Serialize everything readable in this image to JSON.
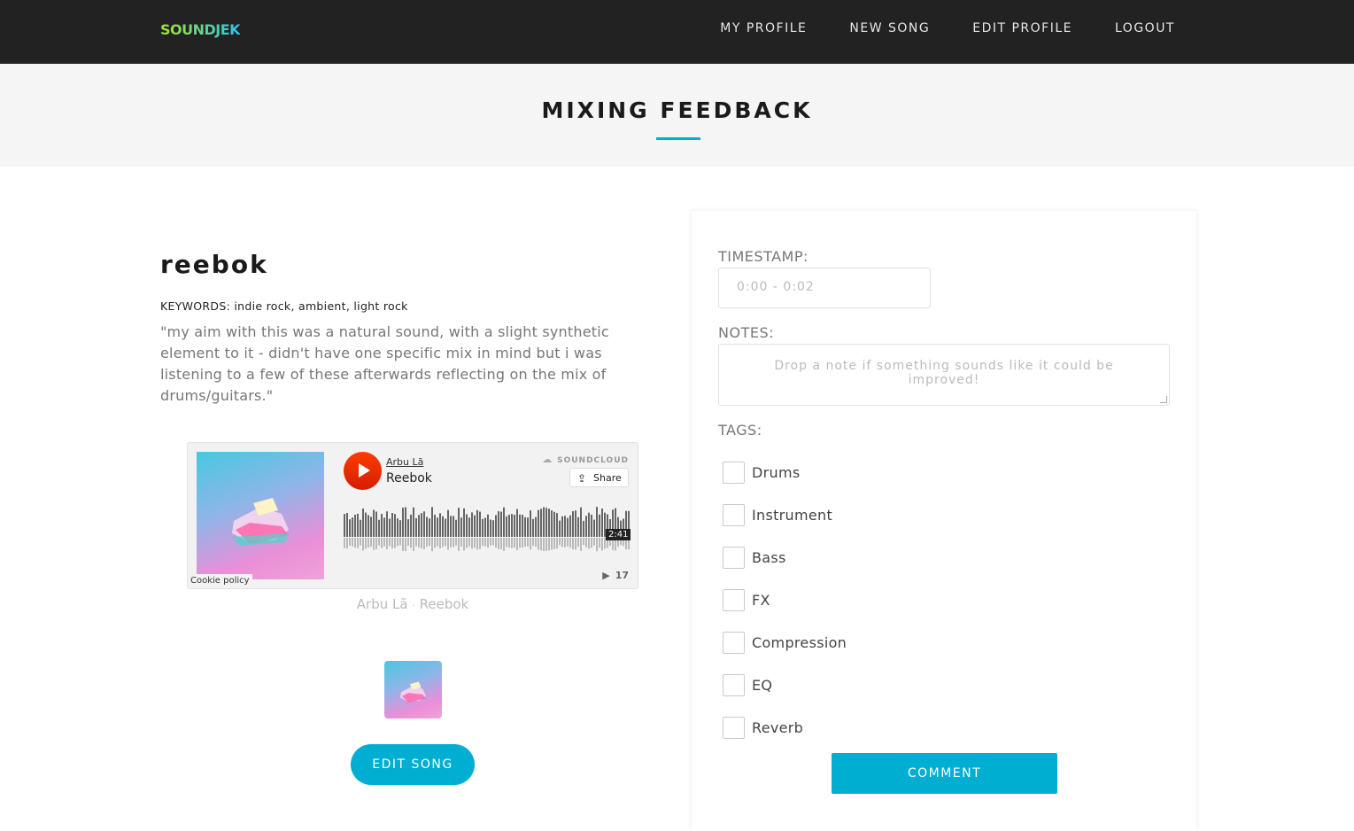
{
  "brand": {
    "logo": "SOUNDJEK"
  },
  "nav": {
    "items": [
      {
        "label": "MY PROFILE"
      },
      {
        "label": "NEW SONG"
      },
      {
        "label": "EDIT PROFILE"
      },
      {
        "label": "LOGOUT"
      }
    ]
  },
  "banner": {
    "title": "MIXING FEEDBACK"
  },
  "song": {
    "title": "reebok",
    "keywords": "KEYWORDS: indie rock, ambient, light rock",
    "description": "\"my aim with this was a natural sound, with a slight synthetic element to it - didn't have one specific mix in mind but i was listening to a few of these afterwards reflecting on the mix of drums/guitars.\"",
    "edit_label": "EDIT SONG"
  },
  "player": {
    "artist": "Arbu Lã",
    "track": "Reebok",
    "brand": "SOUNDCLOUD",
    "share_label": "Share",
    "share_icon": "share-icon",
    "duration": "2:41",
    "plays": "17",
    "plays_icon": "play-icon",
    "cookie_policy": "Cookie policy",
    "caption_artist": "Arbu Lã",
    "caption_sep": "·",
    "caption_track": "Reebok",
    "accent": "#ff3c00"
  },
  "form": {
    "timestamp_label": "TIMESTAMP:",
    "timestamp_value": "0:00 - 0:02",
    "notes_label": "NOTES:",
    "notes_placeholder": "Drop a note if something sounds like it could be improved!",
    "tags_label": "TAGS:",
    "tags": [
      {
        "label": "Drums",
        "checked": false
      },
      {
        "label": "Instrument",
        "checked": false
      },
      {
        "label": "Bass",
        "checked": false
      },
      {
        "label": "FX",
        "checked": false
      },
      {
        "label": "Compression",
        "checked": false
      },
      {
        "label": "EQ",
        "checked": false
      },
      {
        "label": "Reverb",
        "checked": false
      }
    ],
    "submit_label": "COMMENT"
  },
  "colors": {
    "accent": "#00aed1",
    "nav_bg": "#222222",
    "banner_bg": "#f5f5f5"
  }
}
